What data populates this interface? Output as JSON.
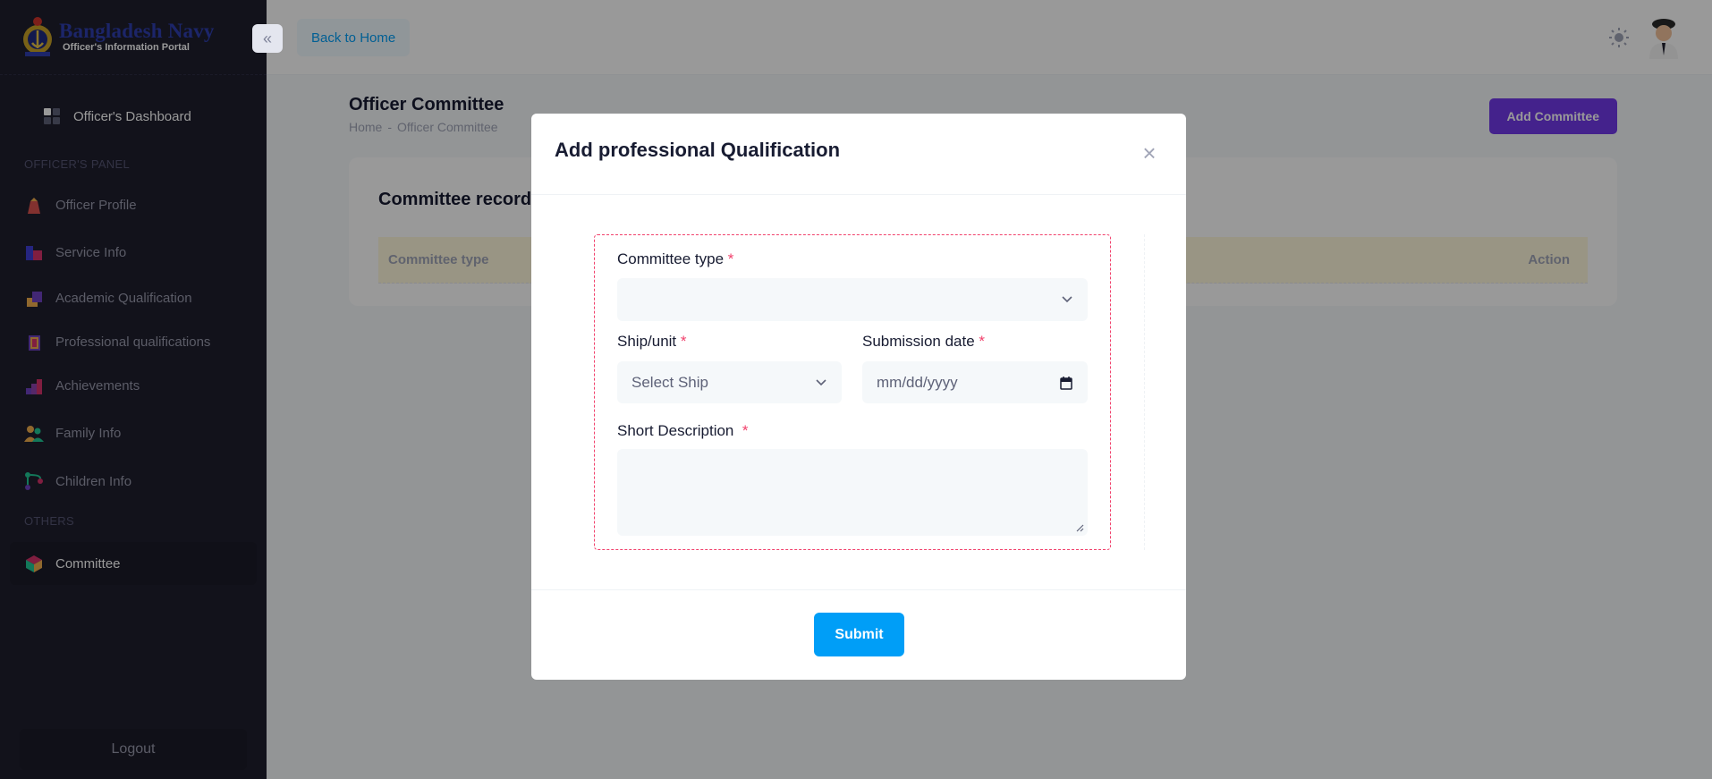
{
  "brand": {
    "title": "Bangladesh Navy",
    "subtitle": "Officer's Information Portal"
  },
  "sidebar": {
    "dashboard": "Officer's Dashboard",
    "panel_label": "OFFICER'S PANEL",
    "items": [
      {
        "label": "Officer Profile",
        "icon": "officer-profile-icon"
      },
      {
        "label": "Service Info",
        "icon": "service-info-icon"
      },
      {
        "label": "Academic Qualification",
        "icon": "academic-qualification-icon"
      },
      {
        "label": "Professional qualifications",
        "icon": "professional-qualifications-icon"
      },
      {
        "label": "Achievements",
        "icon": "achievements-icon"
      },
      {
        "label": "Family Info",
        "icon": "family-info-icon"
      },
      {
        "label": "Children Info",
        "icon": "children-info-icon"
      }
    ],
    "others_label": "OTHERS",
    "committee": "Committee",
    "logout": "Logout"
  },
  "header": {
    "back_label": "Back to Home"
  },
  "page": {
    "title": "Officer Committee",
    "breadcrumb": [
      "Home",
      "Officer Committee"
    ],
    "add_button": "Add Committee",
    "card_title": "Committee record",
    "columns": [
      "Committee type",
      "Action"
    ]
  },
  "modal": {
    "title": "Add professional Qualification",
    "committee_type_label": "Committee type",
    "committee_type_value": "",
    "ship_label": "Ship/unit",
    "ship_value": "Select Ship",
    "date_label": "Submission date",
    "date_placeholder": "mm/dd/yyyy",
    "description_label": "Short Description",
    "required_mark": "*",
    "submit": "Submit"
  },
  "colors": {
    "sidebar_bg": "#1e1e2d",
    "primary": "#009ef7",
    "purple": "#7239ea",
    "danger": "#f1416c"
  }
}
